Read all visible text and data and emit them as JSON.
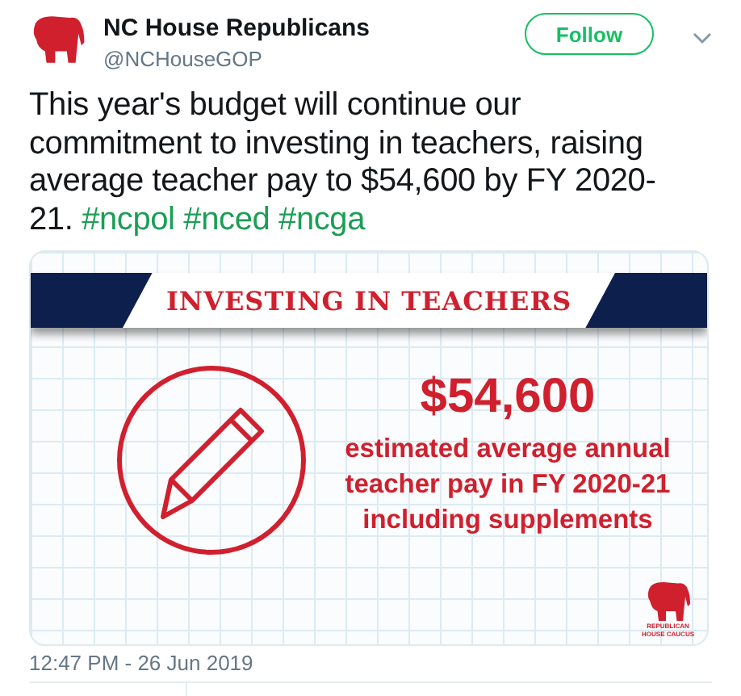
{
  "author": {
    "name": "NC House Republicans",
    "handle": "@NCHouseGOP"
  },
  "follow_button": {
    "label": "Follow"
  },
  "tweet": {
    "text": "This year's budget will continue our commitment to investing in teachers, raising average teacher pay to $54,600 by FY 2020-21.",
    "hashtags": [
      "#ncpol",
      "#nced",
      "#ncga"
    ]
  },
  "card": {
    "banner": "INVESTING IN TEACHERS",
    "amount": "$54,600",
    "caption_lines": [
      "estimated average annual",
      "teacher pay in FY 2020-21",
      "including supplements"
    ],
    "logo_lines": [
      "REPUBLICAN",
      "HOUSE CAUCUS"
    ]
  },
  "timestamp": "12:47 PM - 26 Jun 2019"
}
